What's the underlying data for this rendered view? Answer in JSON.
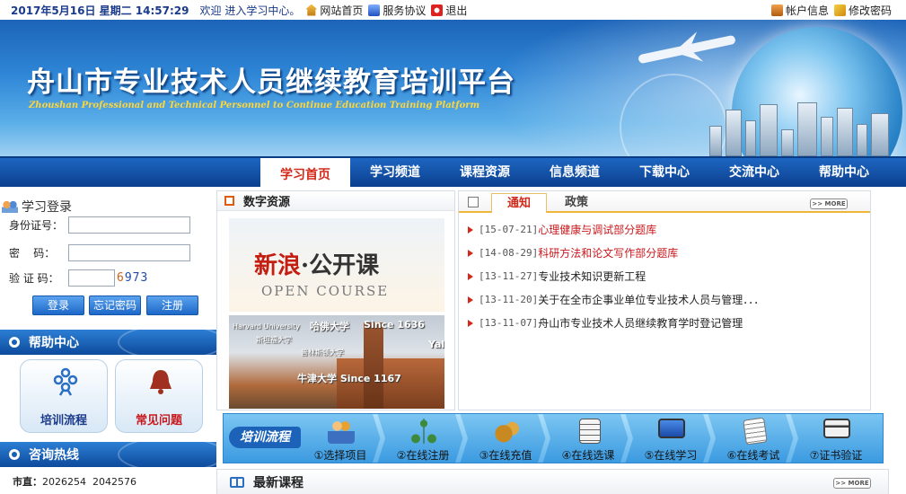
{
  "topbar": {
    "datetime": "2017年5月16日 星期二 14:57:29",
    "welcome": "欢迎 进入学习中心。",
    "links": [
      "网站首页",
      "服务协议",
      "退出"
    ],
    "account_info": "帐户信息",
    "change_password": "修改密码"
  },
  "banner": {
    "title_cn": "舟山市专业技术人员继续教育培训平台",
    "title_en": "Zhoushan Professional and Technical Personnel to Continue Education Training Platform"
  },
  "nav": {
    "tabs": [
      "学习首页",
      "学习频道",
      "课程资源",
      "信息频道",
      "下载中心",
      "交流中心",
      "帮助中心"
    ]
  },
  "login": {
    "title": "学习登录",
    "id_label": "身份证号：",
    "password_label": "密    码：",
    "captcha_label": "验 证 码：",
    "captcha_digits": [
      "6",
      "9",
      "7",
      "3"
    ],
    "captcha_colors": [
      "#d0601a",
      "#1f4aa8",
      "#1f4aa8",
      "#1f4aa8"
    ],
    "buttons": [
      "登录",
      "忘记密码",
      "注册"
    ]
  },
  "help": {
    "title": "帮助中心",
    "items": [
      "培训流程",
      "常见问题"
    ]
  },
  "hotline": {
    "title": "咨询热线",
    "city_label": "市直：",
    "city_numbers": "2026254  2042576"
  },
  "resources": {
    "title": "数字资源",
    "promo1": {
      "brand": "新浪",
      "dot": "·",
      "course": "公开课",
      "en": "OPEN COURSE"
    },
    "promo2": {
      "labels": [
        "哈佛大学",
        "Since 1636",
        "斯坦福大学",
        "普林斯顿大学",
        "牛津大学 Since 1167",
        "Yal",
        "Harvard University"
      ]
    }
  },
  "notices": {
    "tabs": [
      "通知",
      "政策"
    ],
    "more": "MORE",
    "items": [
      {
        "date": "[15-07-21]",
        "title": "心理健康与调试部分题库",
        "highlight": true
      },
      {
        "date": "[14-08-29]",
        "title": "科研方法和论文写作部分题库",
        "highlight": true
      },
      {
        "date": "[13-11-27]",
        "title": "专业技术知识更新工程",
        "highlight": false
      },
      {
        "date": "[13-11-20]",
        "title": "关于在全市企事业单位专业技术人员与管理．．．",
        "highlight": false
      },
      {
        "date": "[13-11-07]",
        "title": "舟山市专业技术人员继续教育学时登记管理",
        "highlight": false
      }
    ]
  },
  "process": {
    "label": "培训流程",
    "steps": [
      {
        "label": "①选择项目",
        "icon": "people-icon",
        "color": "#e8a030"
      },
      {
        "label": "②在线注册",
        "icon": "network-icon",
        "color": "#3d8a3d"
      },
      {
        "label": "③在线充值",
        "icon": "money-bag-icon",
        "color": "#c88a20"
      },
      {
        "label": "④在线选课",
        "icon": "checklist-icon",
        "color": "#f4f4f4"
      },
      {
        "label": "⑤在线学习",
        "icon": "monitor-icon",
        "color": "#2a5ec0"
      },
      {
        "label": "⑥在线考试",
        "icon": "exam-paper-icon",
        "color": "#f4f4f4"
      },
      {
        "label": "⑦证书验证",
        "icon": "certificate-icon",
        "color": "#3a3a3a"
      }
    ]
  },
  "latest": {
    "title": "最新课程",
    "more": "MORE"
  }
}
